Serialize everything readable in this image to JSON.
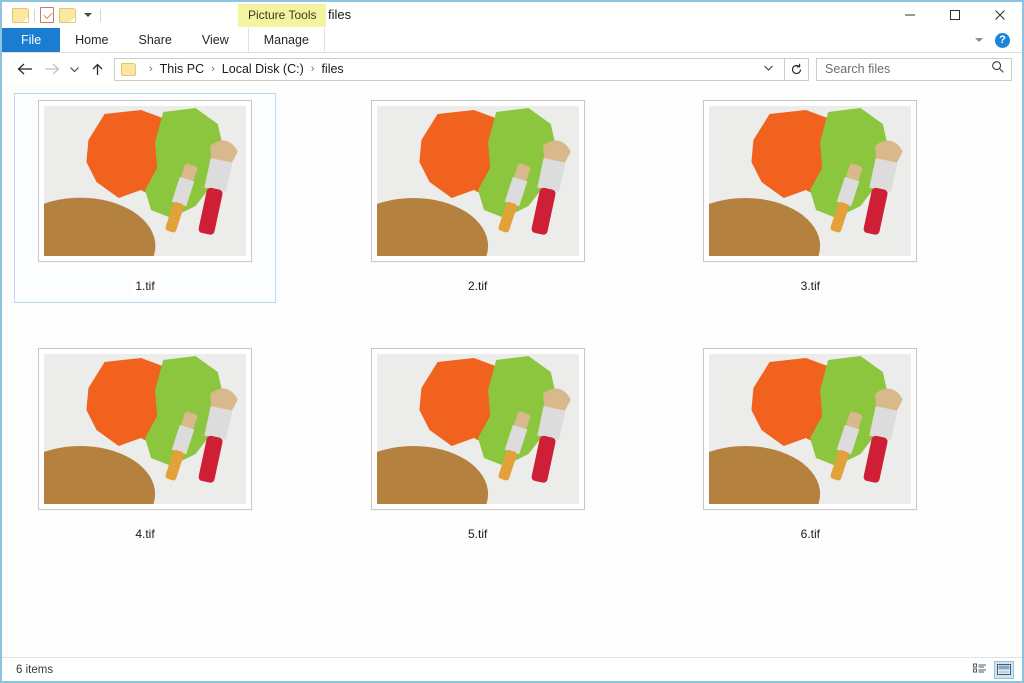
{
  "window": {
    "title": "files",
    "border_color": "#8cc3dd",
    "quick_access": [
      {
        "name": "folder-icon",
        "label": "Folder"
      },
      {
        "name": "properties-icon",
        "label": "Properties"
      },
      {
        "name": "new-folder-icon",
        "label": "New folder"
      },
      {
        "name": "customize-chevron-icon",
        "label": "Customize Quick Access Toolbar"
      }
    ],
    "controls": {
      "minimize": "—",
      "maximize": "☐",
      "close": "✕"
    }
  },
  "ribbon": {
    "contextual_group": "Picture Tools",
    "contextual_color": "#f4f4a0",
    "accent_color": "#1a7dd0",
    "tabs": [
      {
        "label": "File",
        "type": "file"
      },
      {
        "label": "Home",
        "type": "normal"
      },
      {
        "label": "Share",
        "type": "normal"
      },
      {
        "label": "View",
        "type": "normal"
      },
      {
        "label": "Manage",
        "type": "contextual"
      }
    ],
    "collapse_label": "Minimize the Ribbon",
    "help_label": "?"
  },
  "address": {
    "back_label": "Back",
    "forward_label": "Forward",
    "recent_label": "Recent locations",
    "up_label": "Up",
    "breadcrumb": [
      "This PC",
      "Local Disk (C:)",
      "files"
    ],
    "separator": "›",
    "refresh_label": "Refresh",
    "dropdown_label": "Previous locations"
  },
  "search": {
    "placeholder": "Search files",
    "value": "",
    "icon": "search-icon"
  },
  "files": [
    {
      "name": "1.tif",
      "selected": true
    },
    {
      "name": "2.tif",
      "selected": false
    },
    {
      "name": "3.tif",
      "selected": false
    },
    {
      "name": "4.tif",
      "selected": false
    },
    {
      "name": "5.tif",
      "selected": false
    },
    {
      "name": "6.tif",
      "selected": false
    }
  ],
  "thumbnail": {
    "description": "Orange and green paint strokes with two paintbrushes on a wooden palette",
    "background": "#ececeb",
    "orange": "#f0621d",
    "green": "#8cc63e",
    "palette_brown": "#b5813f",
    "handle_red": "#cf1f36",
    "handle_tan": "#e3a13a",
    "ferrule": "#d8d8d8",
    "bristle": "#d9b98c"
  },
  "status": {
    "item_count": "6 items",
    "views": [
      {
        "name": "details-view-button",
        "label": "Details view",
        "active": false
      },
      {
        "name": "large-icons-view-button",
        "label": "Large icons view",
        "active": true
      }
    ]
  }
}
